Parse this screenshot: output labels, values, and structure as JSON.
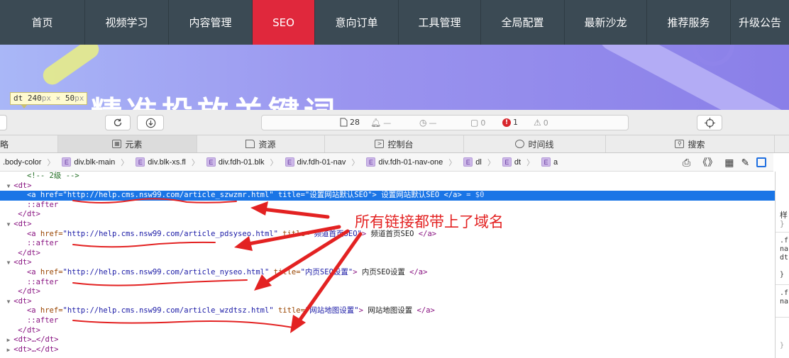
{
  "topnav": {
    "items": [
      "首页",
      "视频学习",
      "内容管理",
      "SEO",
      "意向订单",
      "工具管理",
      "全局配置",
      "最新沙龙",
      "推荐服务",
      "升级公告"
    ],
    "active": "SEO"
  },
  "banner": {
    "headline": "精准投放关键词",
    "tooltip_tag": "dt",
    "tooltip_w": "240",
    "tooltip_h": "50",
    "tooltip_unit": "px",
    "tooltip_times": "×"
  },
  "toolbar": {
    "resources_count": "28",
    "network_count": "—",
    "timeline_count": "—",
    "log_count": "0",
    "error_count": "1",
    "warning_count": "0"
  },
  "tabs": [
    {
      "label": "略",
      "icon": "truncated"
    },
    {
      "label": "元素",
      "icon": "elements-icon"
    },
    {
      "label": "资源",
      "icon": "resources-icon"
    },
    {
      "label": "控制台",
      "icon": "console-icon"
    },
    {
      "label": "时间线",
      "icon": "timeline-icon"
    },
    {
      "label": "搜索",
      "icon": "search-icon"
    }
  ],
  "breadcrumb": [
    {
      "label": ".body-color",
      "badge": ""
    },
    {
      "label": "div.blk-main",
      "badge": "E"
    },
    {
      "label": "div.blk-xs.fl",
      "badge": "E"
    },
    {
      "label": "div.fdh-01.blk",
      "badge": "E"
    },
    {
      "label": "div.fdh-01-nav",
      "badge": "E"
    },
    {
      "label": "div.fdh-01-nav-one",
      "badge": "E"
    },
    {
      "label": "dl",
      "badge": "E"
    },
    {
      "label": "dt",
      "badge": "E"
    },
    {
      "label": "a",
      "badge": "E"
    }
  ],
  "dom": {
    "comment": "<!-- 2级 -->",
    "dt_open": "<dt>",
    "dt_close": "</dt>",
    "after": "::after",
    "collapsed": "<dt>…</dt>",
    "selected_suffix": "= $0",
    "links": [
      {
        "href": "http://help.cms.nsw99.com/article_szwzmr.html",
        "title": "设置网站默认SEO",
        "text": "设置网站默认SEO"
      },
      {
        "href": "http://help.cms.nsw99.com/article_pdsyseo.html",
        "title": "频道首页SEO",
        "text": "频道首页SEO"
      },
      {
        "href": "http://help.cms.nsw99.com/article_nyseo.html",
        "title": "内页SEO设置",
        "text": "内页SEO设置"
      },
      {
        "href": "http://help.cms.nsw99.com/article_wzdtsz.html",
        "title": "网站地图设置",
        "text": "网站地图设置"
      }
    ]
  },
  "side_panel": [
    "样",
    "}",
    ".f",
    "na",
    "dt",
    "}",
    ".f",
    "na",
    "}"
  ],
  "annotation": {
    "note": "所有链接都带上了域名",
    "color": "#e32222"
  },
  "colors": {
    "nav_bg": "#3b4a54",
    "nav_active": "#e0283c",
    "selection": "#1a75e6"
  }
}
